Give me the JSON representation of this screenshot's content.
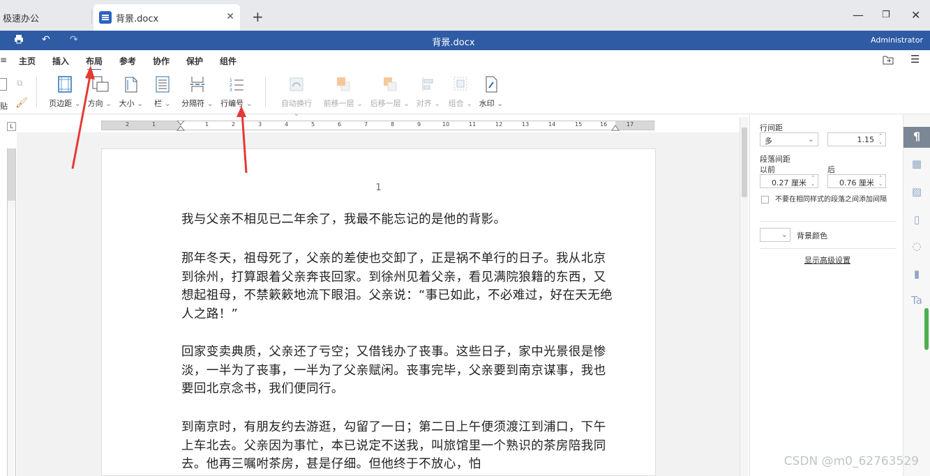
{
  "tabs": {
    "first": "极速办公",
    "active": "背景.docx"
  },
  "window": {
    "title": "背景.docx",
    "user": "Administrator"
  },
  "menu": [
    "主页",
    "插入",
    "布局",
    "参考",
    "协作",
    "保护",
    "组件"
  ],
  "menu_active": "布局",
  "ribbon": {
    "paste_partial": "贴",
    "margins": "页边距",
    "orientation": "方向",
    "size": "大小",
    "columns": "栏",
    "breaks": "分隔符",
    "line_numbers": "行编号",
    "text_wrap": "自动换行",
    "bring_forward": "前移一层",
    "send_backward": "后移一层",
    "align": "对齐",
    "group": "组合",
    "watermark": "水印"
  },
  "ruler_labels": [
    "2",
    "1",
    "1",
    "2",
    "3",
    "4",
    "5",
    "6",
    "7",
    "8",
    "9",
    "10",
    "11",
    "12",
    "13",
    "14",
    "15",
    "16",
    "17"
  ],
  "document": {
    "page_number": "1",
    "paragraphs": [
      "我与父亲不相见已二年余了，我最不能忘记的是他的背影。",
      "那年冬天，祖母死了，父亲的差使也交卸了，正是祸不单行的日子。我从北京到徐州，打算跟着父亲奔丧回家。到徐州见着父亲，看见满院狼籍的东西，又想起祖母，不禁簌簌地流下眼泪。父亲说：“事已如此，不必难过，好在天无绝人之路！”",
      "回家变卖典质，父亲还了亏空；又借钱办了丧事。这些日子，家中光景很是惨淡，一半为了丧事，一半为了父亲赋闲。丧事完毕，父亲要到南京谋事，我也要回北京念书，我们便同行。",
      "到南京时，有朋友约去游逛，勾留了一日；第二日上午便须渡江到浦口，下午上车北去。父亲因为事忙，本已说定不送我，叫旅馆里一个熟识的茶房陪我同去。他再三嘱咐茶房，甚是仔细。但他终于不放心，怕"
    ]
  },
  "panel": {
    "line_spacing_label": "行间距",
    "line_spacing_mode": "多",
    "line_spacing_value": "1.15",
    "para_spacing_label": "段落间距",
    "before_label": "以前",
    "after_label": "后",
    "before_value": "0.27 厘米",
    "after_value": "0.76 厘米",
    "no_space_checkbox": "不要在相同样式的段落之间添加间隔",
    "bg_color_label": "背景颜色",
    "advanced_link": "显示高级设置"
  },
  "watermark_text": "CSDN @m0_62763529",
  "colors": {
    "titlebar": "#2e5ba4",
    "accent": "#2b62c4",
    "arrow": "#e53935"
  }
}
